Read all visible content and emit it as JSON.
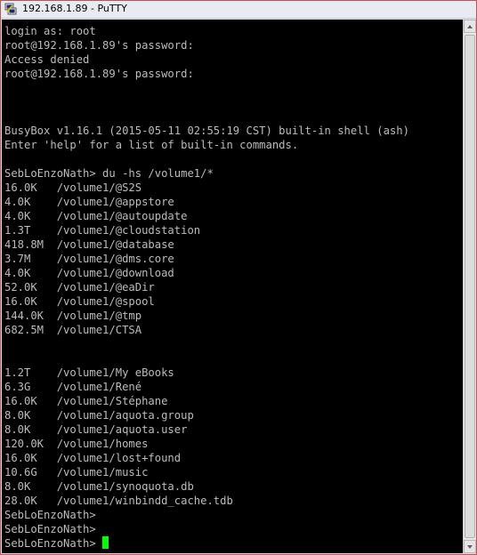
{
  "window": {
    "title": "192.168.1.89 - PuTTY",
    "app_icon": "putty-icon"
  },
  "terminal": {
    "lines": [
      "login as: root",
      "root@192.168.1.89's password:",
      "Access denied",
      "root@192.168.1.89's password:",
      "",
      "",
      "",
      "BusyBox v1.16.1 (2015-05-11 02:55:19 CST) built-in shell (ash)",
      "Enter 'help' for a list of built-in commands.",
      "",
      "SebLoEnzoNath> du -hs /volume1/*",
      "16.0K   /volume1/@S2S",
      "4.0K    /volume1/@appstore",
      "4.0K    /volume1/@autoupdate",
      "1.3T    /volume1/@cloudstation",
      "418.8M  /volume1/@database",
      "3.7M    /volume1/@dms.core",
      "4.0K    /volume1/@download",
      "52.0K   /volume1/@eaDir",
      "16.0K   /volume1/@spool",
      "144.0K  /volume1/@tmp",
      "682.5M  /volume1/CTSA",
      "",
      "",
      "1.2T    /volume1/My eBooks",
      "6.3G    /volume1/René",
      "16.0K   /volume1/Stéphane",
      "8.0K    /volume1/aquota.group",
      "8.0K    /volume1/aquota.user",
      "120.0K  /volume1/homes",
      "16.0K   /volume1/lost+found",
      "10.6G   /volume1/music",
      "8.0K    /volume1/synoquota.db",
      "28.0K   /volume1/winbindd_cache.tdb",
      "SebLoEnzoNath>",
      "SebLoEnzoNath>",
      "SebLoEnzoNath> "
    ],
    "cursor_color": "#00ff00",
    "text_color": "#bbbbbb",
    "background_color": "#000000"
  }
}
